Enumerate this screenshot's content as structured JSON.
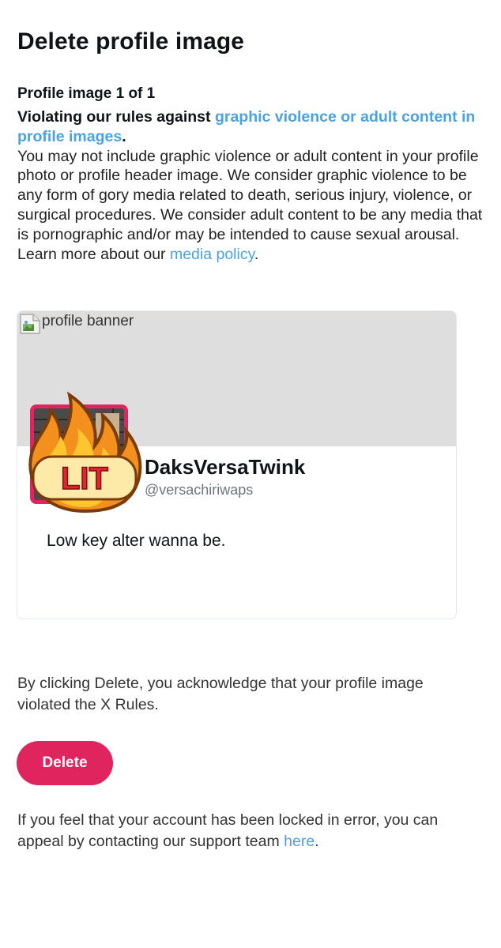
{
  "page": {
    "title": "Delete profile image",
    "counter": "Profile image 1 of 1"
  },
  "rule": {
    "heading_prefix": "Violating our rules against ",
    "heading_link": "graphic violence or adult content in profile images",
    "heading_suffix": ".",
    "body": "You may not include graphic violence or adult content in your profile photo or profile header image. We consider graphic violence to be any form of gory media related to death, serious injury, violence, or surgical procedures. We consider adult content to be any media that is pornographic and/or may be intended to cause sexual arousal. Learn more about our ",
    "body_link": "media policy",
    "body_suffix": "."
  },
  "profile_card": {
    "banner_alt": "profile banner",
    "badge_text": "LIT",
    "display_name": "DaksVersaTwink",
    "handle": "@versachiriwaps",
    "bio": "Low key alter wanna be."
  },
  "acknowledgement": "By clicking Delete, you acknowledge that your profile image violated the X Rules.",
  "delete_button": "Delete",
  "appeal": {
    "text": "If you feel that your account has been locked in error, you can appeal by contacting our support team ",
    "link": "here",
    "suffix": "."
  },
  "colors": {
    "accent_link": "#4aa3df",
    "delete_button": "#e0245e",
    "banner_bg": "#dedede"
  },
  "icons": [
    "broken-image-icon",
    "lit-fire-emoji-icon"
  ]
}
